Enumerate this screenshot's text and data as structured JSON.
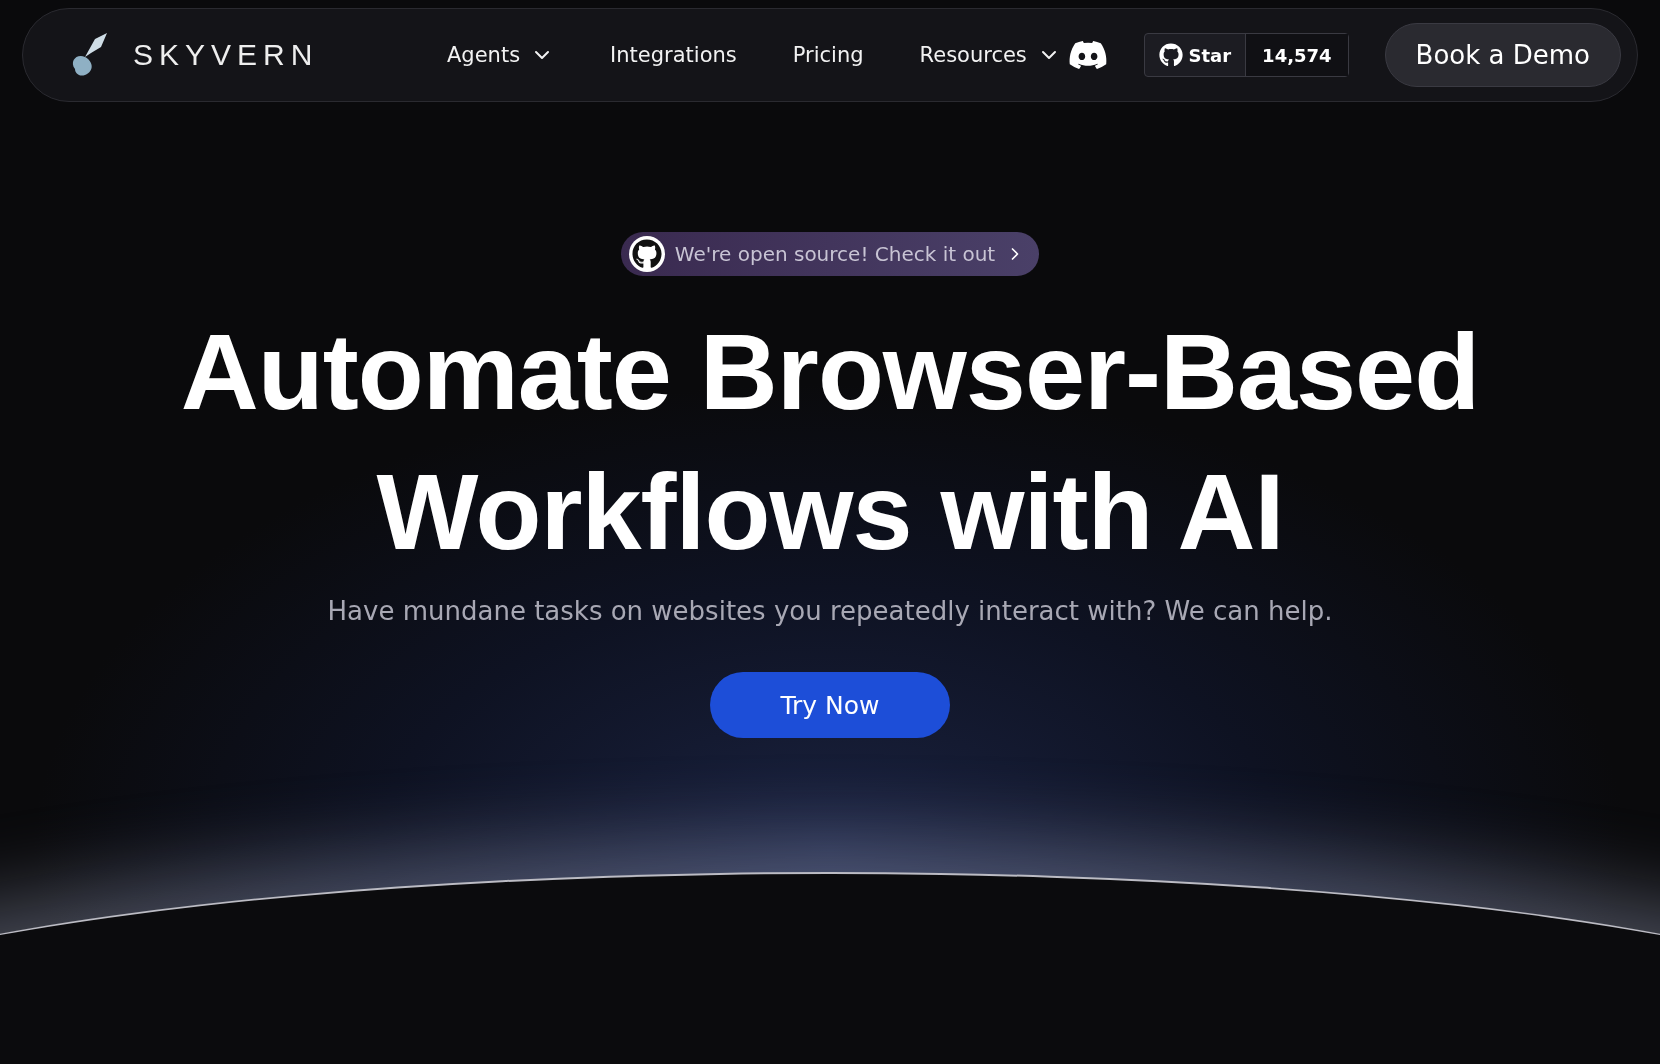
{
  "nav": {
    "brand": "SKYVERN",
    "items": [
      {
        "label": "Agents",
        "kind": "dropdown"
      },
      {
        "label": "Integrations",
        "kind": "link"
      },
      {
        "label": "Pricing",
        "kind": "link"
      },
      {
        "label": "Resources",
        "kind": "dropdown"
      }
    ],
    "star": {
      "label": "Star",
      "count": "14,574"
    },
    "cta": "Book a Demo"
  },
  "hero": {
    "badge": {
      "text": "We're open source! Check it out"
    },
    "headline": [
      "Automate Browser-Based",
      "Workflows with AI"
    ],
    "subtitle": "Have mundane tasks on websites you repeatedly interact with? We can help.",
    "button": "Try Now"
  }
}
